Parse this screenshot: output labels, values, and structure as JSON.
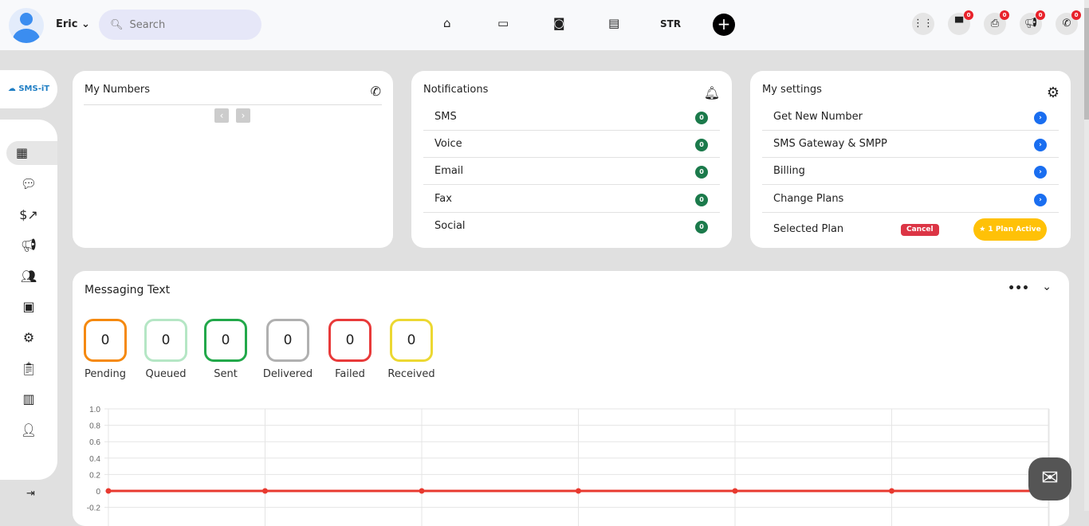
{
  "header": {
    "user": "Eric",
    "search_placeholder": "Search",
    "nav_str": "STR",
    "badges": [
      "0",
      "0",
      "0",
      "0"
    ]
  },
  "sidebar": {
    "logo": "SMS-iT",
    "items": [
      "dashboard-icon",
      "chat-icon",
      "money-growth-icon",
      "megaphone-icon",
      "users-gear-icon",
      "chip-icon",
      "gear-icon",
      "clipboard-icon",
      "store-icon",
      "user-icon"
    ]
  },
  "my_numbers": {
    "title": "My Numbers"
  },
  "notifications": {
    "title": "Notifications",
    "items": [
      {
        "label": "SMS",
        "count": "0"
      },
      {
        "label": "Voice",
        "count": "0"
      },
      {
        "label": "Email",
        "count": "0"
      },
      {
        "label": "Fax",
        "count": "0"
      },
      {
        "label": "Social",
        "count": "0"
      }
    ]
  },
  "settings": {
    "title": "My settings",
    "items": [
      "Get New Number",
      "SMS Gateway & SMPP",
      "Billing",
      "Change Plans"
    ],
    "selected_plan": "Selected Plan",
    "cancel": "Cancel",
    "plan_active": "1 Plan Active"
  },
  "messaging": {
    "title": "Messaging Text",
    "stats": [
      {
        "label": "Pending",
        "value": "0",
        "color": "#f5890f"
      },
      {
        "label": "Queued",
        "value": "0",
        "color": "#b5e6c5"
      },
      {
        "label": "Sent",
        "value": "0",
        "color": "#22a84a"
      },
      {
        "label": "Delivered",
        "value": "0",
        "color": "#b0b0b0"
      },
      {
        "label": "Failed",
        "value": "0",
        "color": "#e83a3a"
      },
      {
        "label": "Received",
        "value": "0",
        "color": "#ecd832"
      }
    ]
  },
  "chart_data": {
    "type": "line",
    "values": [
      0,
      0,
      0,
      0,
      0,
      0,
      0
    ],
    "ylim": [
      -0.2,
      1.0
    ],
    "yticks": [
      "1.0",
      "0.8",
      "0.6",
      "0.4",
      "0.2",
      "0",
      "-0.2"
    ],
    "grid": true,
    "color": "#e8392f"
  }
}
